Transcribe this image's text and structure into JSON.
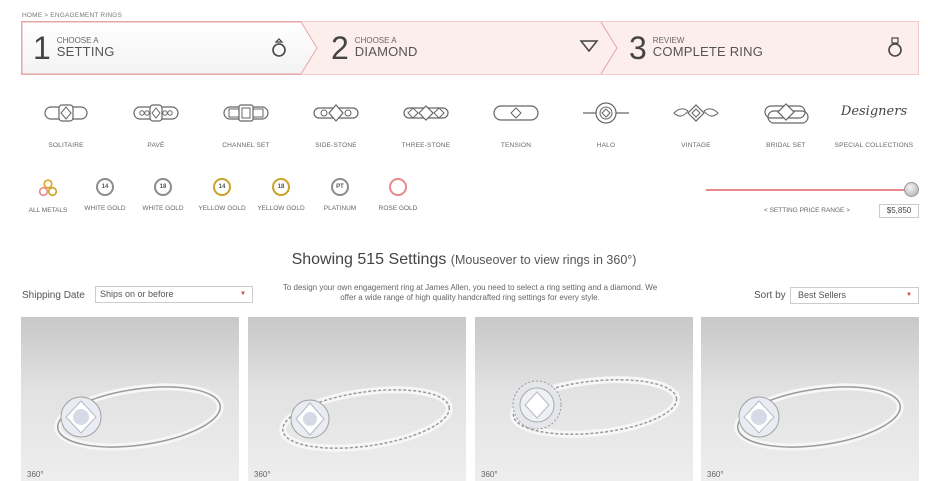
{
  "breadcrumb": "HOME > ENGAGEMENT RINGS",
  "steps": [
    {
      "num": "1",
      "small": "CHOOSE A",
      "big": "SETTING",
      "icon": "ring-icon"
    },
    {
      "num": "2",
      "small": "CHOOSE A",
      "big": "DIAMOND",
      "icon": "diamond-icon"
    },
    {
      "num": "3",
      "small": "REVIEW",
      "big": "COMPLETE RING",
      "icon": "ring-icon"
    }
  ],
  "styles": [
    {
      "label": "SOLITAIRE",
      "icon": "solitaire-ring-icon"
    },
    {
      "label": "PAVÉ",
      "icon": "pave-ring-icon"
    },
    {
      "label": "CHANNEL SET",
      "icon": "channel-set-ring-icon"
    },
    {
      "label": "SIDE-STONE",
      "icon": "side-stone-ring-icon"
    },
    {
      "label": "THREE-STONE",
      "icon": "three-stone-ring-icon"
    },
    {
      "label": "TENSION",
      "icon": "tension-ring-icon"
    },
    {
      "label": "HALO",
      "icon": "halo-ring-icon"
    },
    {
      "label": "VINTAGE",
      "icon": "vintage-ring-icon"
    },
    {
      "label": "BRIDAL SET",
      "icon": "bridal-set-ring-icon"
    },
    {
      "label": "SPECIAL COLLECTIONS",
      "logo": "Designers",
      "icon": "designers-logo"
    }
  ],
  "metals": [
    {
      "label": "ALL METALS",
      "mark": "",
      "color": "#d9a520"
    },
    {
      "label": "WHITE GOLD",
      "mark": "14",
      "color": "#8c8c8c"
    },
    {
      "label": "WHITE GOLD",
      "mark": "18",
      "color": "#8c8c8c"
    },
    {
      "label": "YELLOW GOLD",
      "mark": "14",
      "color": "#c9a227"
    },
    {
      "label": "YELLOW GOLD",
      "mark": "18",
      "color": "#c9a227"
    },
    {
      "label": "PLATINUM",
      "mark": "PT",
      "color": "#8c8c8c"
    },
    {
      "label": "ROSE GOLD",
      "mark": "",
      "color": "#e88a8a"
    }
  ],
  "price": {
    "label": "< SETTING PRICE RANGE >",
    "value": "$5,850",
    "slider_fraction": 1.0
  },
  "results": {
    "title": "Showing 515 Settings",
    "hint": "(Mouseover to view rings in 360°)"
  },
  "shipping": {
    "label": "Shipping Date",
    "value": "Ships on or before"
  },
  "intro": "To design your own engagement ring at James Allen, you need to select a ring setting and a diamond. We offer a wide range of high quality handcrafted ring settings for every style.",
  "sort": {
    "label": "Sort by",
    "value": "Best Sellers"
  },
  "products": [
    {
      "badge": "360°",
      "style": "solitaire"
    },
    {
      "badge": "360°",
      "style": "pave"
    },
    {
      "badge": "360°",
      "style": "halo"
    },
    {
      "badge": "360°",
      "style": "solitaire"
    }
  ],
  "colors": {
    "accent": "#e88a8a",
    "step_active_bg": "#ffffff",
    "step_bg": "#fdeeee",
    "border": "#eaa5a5"
  }
}
